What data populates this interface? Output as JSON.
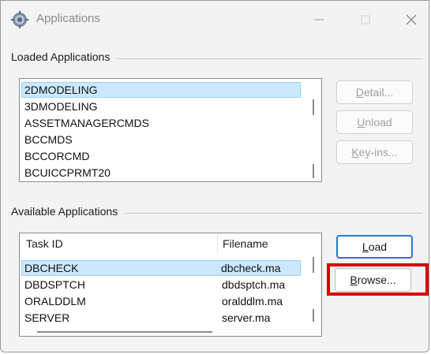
{
  "window": {
    "title": "Applications",
    "icon": "gear-icon",
    "controls": [
      "minimize-icon",
      "maximize-icon",
      "close-icon"
    ]
  },
  "loaded": {
    "group_label": "Loaded Applications",
    "items": [
      {
        "label": "2DMODELING",
        "selected": true
      },
      {
        "label": "3DMODELING",
        "selected": false
      },
      {
        "label": "ASSETMANAGERCMDS",
        "selected": false
      },
      {
        "label": "BCCMDS",
        "selected": false
      },
      {
        "label": "BCCORCMD",
        "selected": false
      },
      {
        "label": "BCUICCPRMT20",
        "selected": false
      }
    ],
    "buttons": {
      "detail_pre": "",
      "detail_key": "D",
      "detail_post": "etail...",
      "unload_pre": "",
      "unload_key": "U",
      "unload_post": "nload",
      "keyins_pre": "",
      "keyins_key": "K",
      "keyins_post": "ey-ins..."
    }
  },
  "available": {
    "group_label": "Available Applications",
    "columns": {
      "task_id": "Task ID",
      "filename": "Filename"
    },
    "rows": [
      {
        "task_id": "DBCHECK",
        "filename": "dbcheck.ma",
        "selected": true
      },
      {
        "task_id": "DBDSPTCH",
        "filename": "dbdsptch.ma",
        "selected": false
      },
      {
        "task_id": "ORALDDLM",
        "filename": "oralddlm.ma",
        "selected": false
      },
      {
        "task_id": "SERVER",
        "filename": "server.ma",
        "selected": false
      }
    ],
    "buttons": {
      "load_pre": "",
      "load_key": "L",
      "load_post": "oad",
      "browse_pre": "",
      "browse_key": "B",
      "browse_post": "rowse..."
    }
  },
  "colors": {
    "selection": "#cce8ff",
    "highlight": "#d80000",
    "default_button_border": "#2b78c5"
  }
}
